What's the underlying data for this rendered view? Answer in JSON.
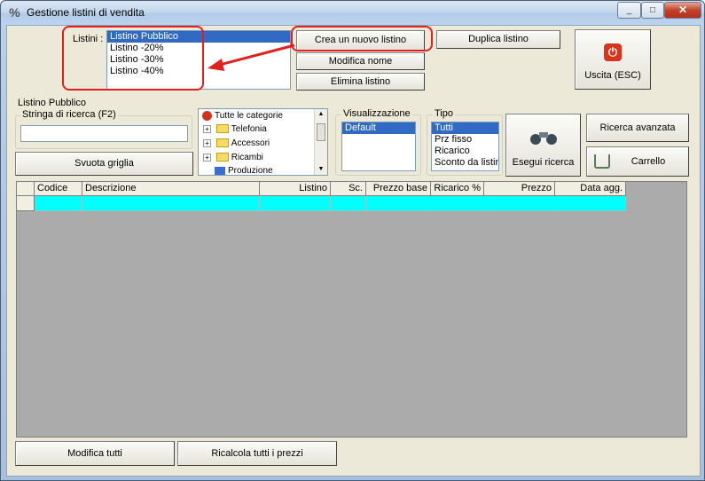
{
  "window": {
    "title": "Gestione listini di vendita",
    "controls": {
      "minimize": "_",
      "maximize": "□",
      "close": "✕"
    }
  },
  "listini": {
    "label": "Listini :",
    "items": [
      "Listino Pubblico",
      "Listino -20%",
      "Listino -30%",
      "Listino -40%"
    ],
    "selected": "Listino Pubblico"
  },
  "buttons": {
    "crea": "Crea un nuovo listino",
    "duplica": "Duplica listino",
    "modifica_nome": "Modifica nome",
    "elimina": "Elimina listino",
    "uscita": "Uscita (ESC)",
    "svuota": "Svuota griglia",
    "esegui": "Esegui ricerca",
    "ricerca_avanzata": "Ricerca avanzata",
    "carrello": "Carrello",
    "modifica_tutti": "Modifica tutti",
    "ricalcola": "Ricalcola tutti i prezzi"
  },
  "search": {
    "current_list_label": "Listino Pubblico",
    "group_title": "Stringa di ricerca (F2)",
    "value": ""
  },
  "categories": {
    "root": "Tutte le categorie",
    "items": [
      "Telefonia",
      "Accessori",
      "Ricambi",
      "Produzione"
    ]
  },
  "visualizzazione": {
    "title": "Visualizzazione",
    "items": [
      "Default"
    ],
    "selected": "Default"
  },
  "tipo": {
    "title": "Tipo",
    "items": [
      "Tutti",
      "Prz fisso",
      "Ricarico",
      "Sconto da listin"
    ],
    "selected": "Tutti"
  },
  "grid": {
    "columns": [
      "Codice",
      "Descrizione",
      "Listino",
      "Sc.",
      "Prezzo base",
      "Ricarico %",
      "Prezzo",
      "Data agg."
    ]
  },
  "colors": {
    "selection": "#316ac5",
    "highlight": "#e0201e",
    "grid_row": "#00ffff",
    "grid_bg": "#ababab"
  }
}
